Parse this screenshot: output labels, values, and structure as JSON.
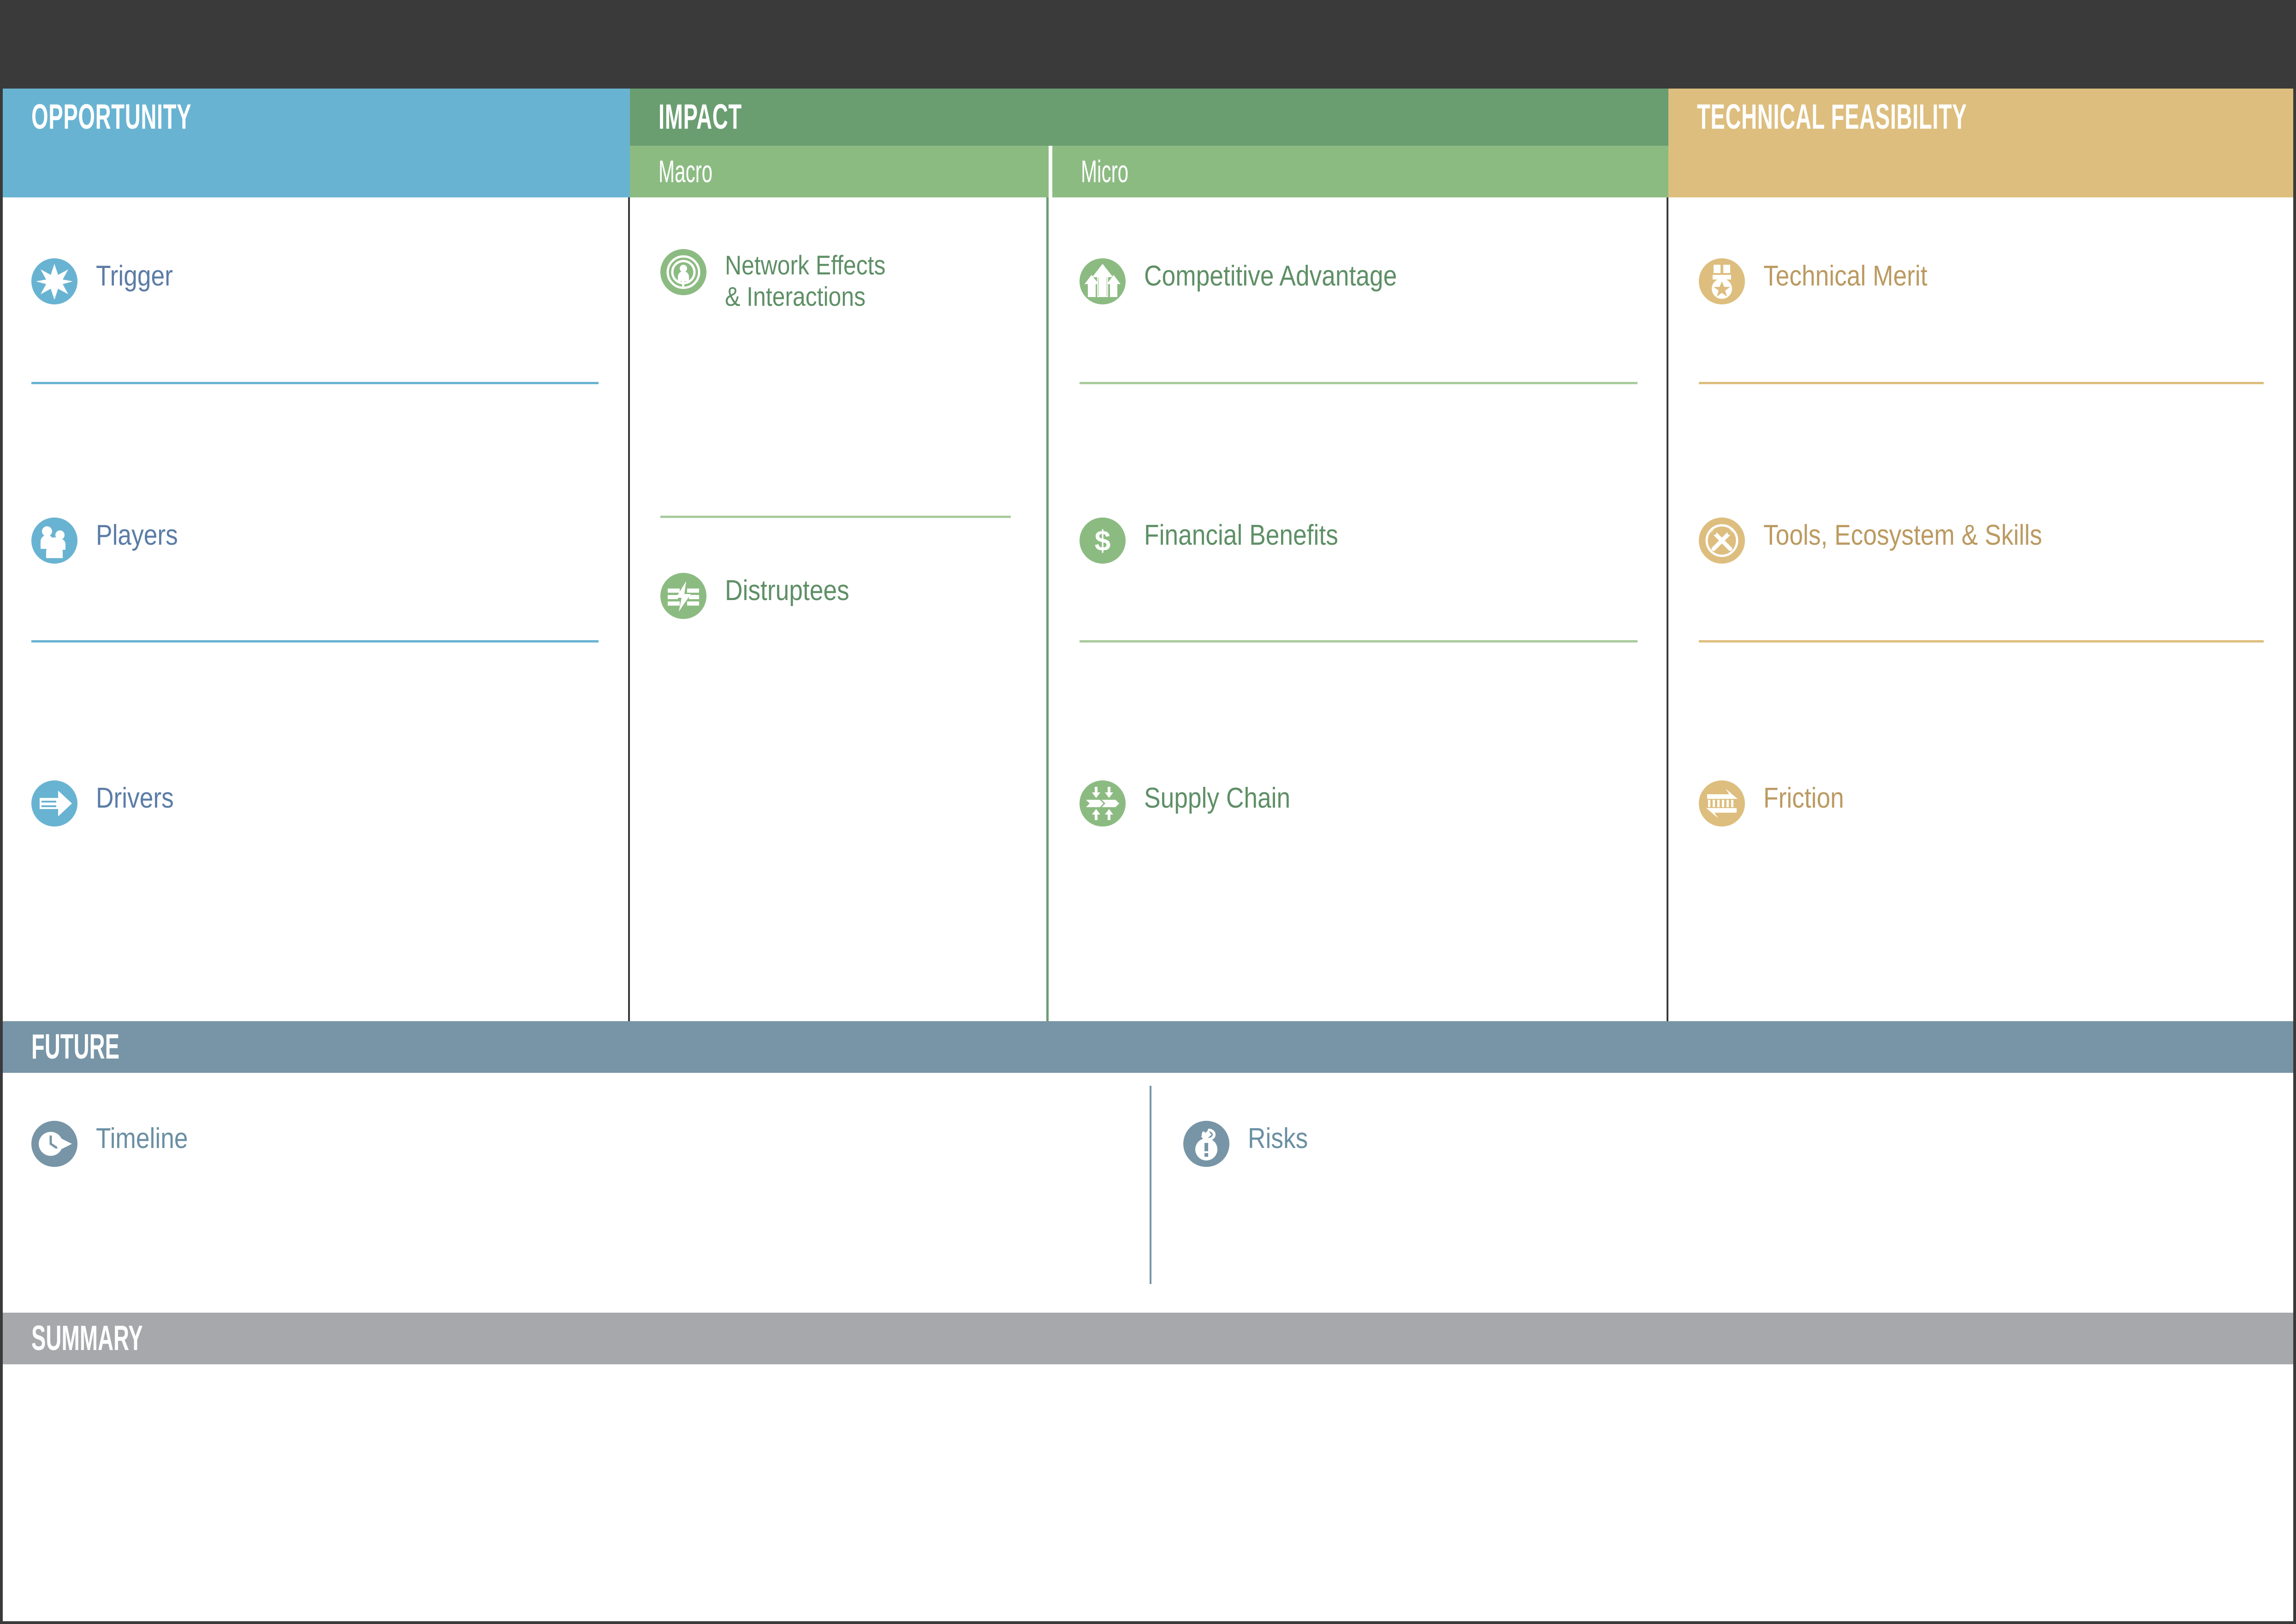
{
  "colors": {
    "top_band": "#3a3a3a",
    "opportunity": "#69b3d2",
    "opportunity_text": "#5b7ca6",
    "impact": "#6a9e71",
    "impact_sub": "#8cbb82",
    "impact_text": "#5e8f66",
    "technical": "#ddbe7e",
    "technical_text": "#bb9a61",
    "future": "#7795a6",
    "future_text": "#6a8fa3",
    "summary": "#a6a8ab",
    "white": "#ffffff"
  },
  "sections": {
    "opportunity": {
      "title": "OPPORTUNITY",
      "items": [
        {
          "label": "Trigger",
          "icon": "starburst-icon"
        },
        {
          "label": "Players",
          "icon": "people-group-icon"
        },
        {
          "label": "Drivers",
          "icon": "right-arrow-icon"
        }
      ]
    },
    "impact": {
      "title": "IMPACT",
      "subcolumns": [
        {
          "title": "Macro",
          "items": [
            {
              "label": "Network Effects\n& Interactions",
              "icon": "network-rings-icon"
            },
            {
              "label": "Distruptees",
              "icon": "lightning-bolt-icon"
            }
          ]
        },
        {
          "title": "Micro",
          "items": [
            {
              "label": "Competitive Advantage",
              "icon": "up-arrows-icon"
            },
            {
              "label": "Financial Benefits",
              "icon": "dollar-sign-icon"
            },
            {
              "label": "Supply Chain",
              "icon": "supply-flow-icon"
            }
          ]
        }
      ]
    },
    "technical": {
      "title": "TECHNICAL FEASIBILITY",
      "items": [
        {
          "label": "Technical Merit",
          "icon": "award-medal-icon"
        },
        {
          "label": "Tools, Ecosystem & Skills",
          "icon": "crossed-tools-icon"
        },
        {
          "label": "Friction",
          "icon": "friction-arrows-icon"
        }
      ]
    },
    "future": {
      "title": "FUTURE",
      "items": [
        {
          "label": "Timeline",
          "icon": "clock-arrow-icon"
        },
        {
          "label": "Risks",
          "icon": "bomb-alert-icon"
        }
      ]
    },
    "summary": {
      "title": "SUMMARY"
    }
  }
}
